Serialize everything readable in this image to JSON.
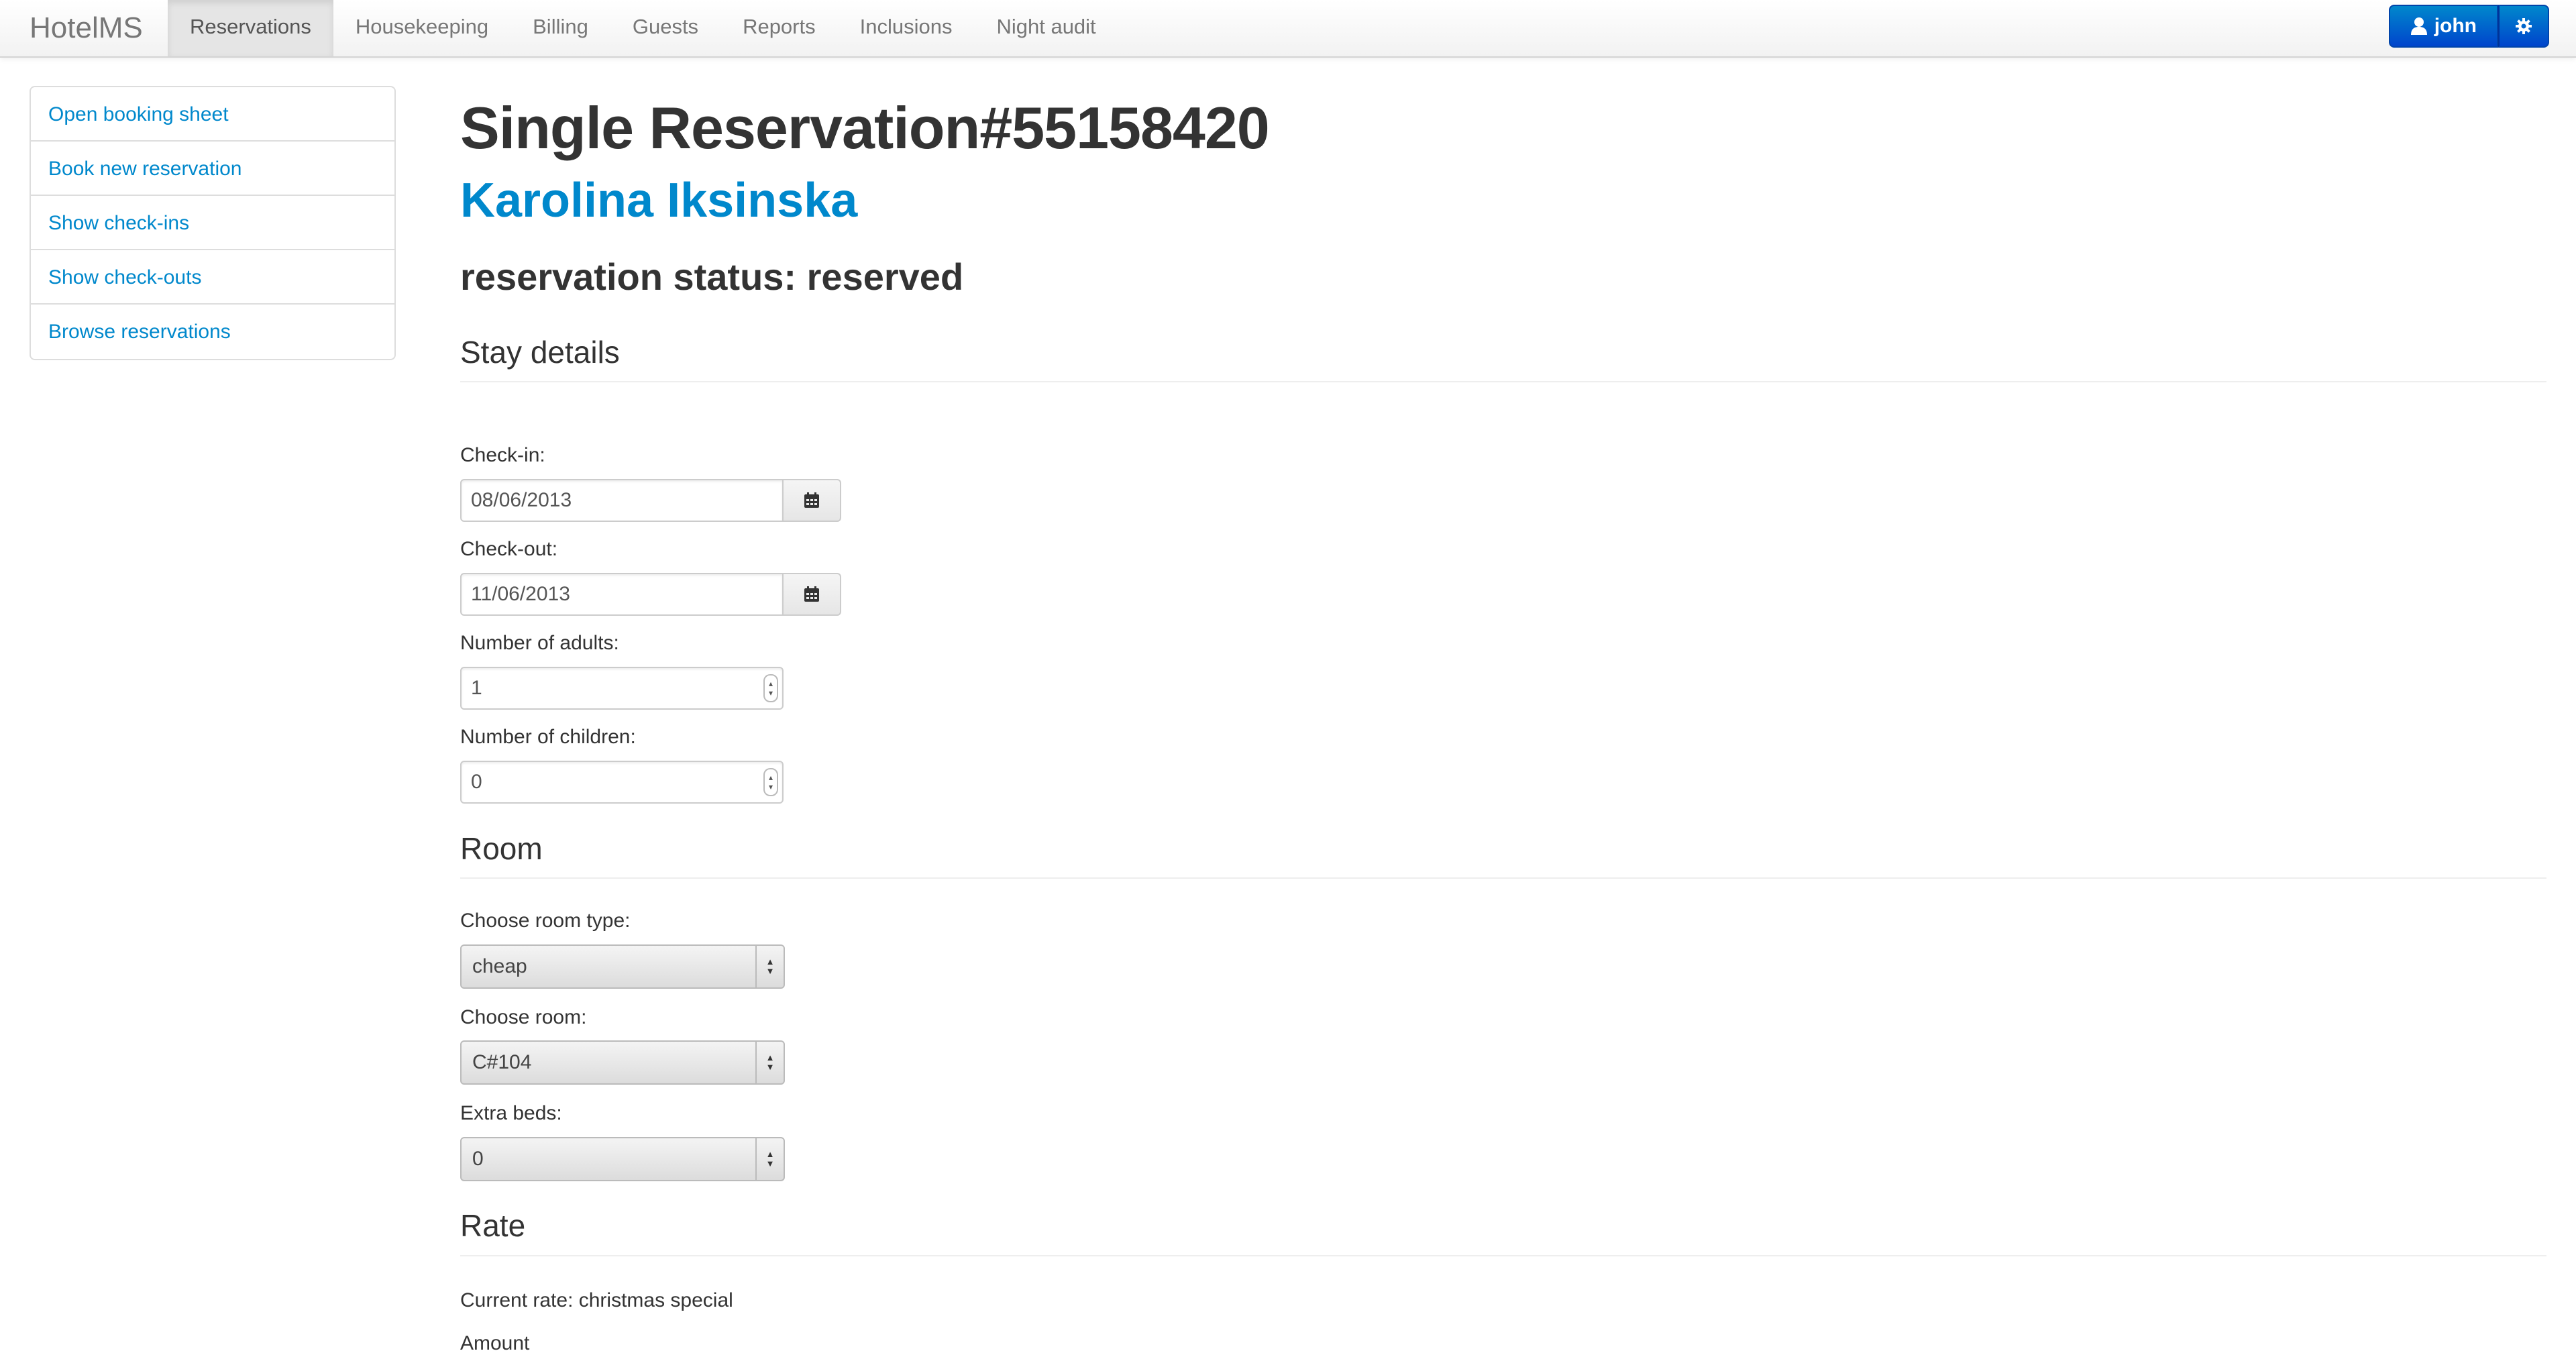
{
  "app": {
    "brand": "HotelMS"
  },
  "nav": {
    "items": [
      "Reservations",
      "Housekeeping",
      "Billing",
      "Guests",
      "Reports",
      "Inclusions",
      "Night audit"
    ],
    "active": "Reservations"
  },
  "user": {
    "name": "john",
    "user_icon": "user-icon",
    "settings_icon": "gear-icon"
  },
  "sidebar": {
    "items": [
      "Open booking sheet",
      "Book new reservation",
      "Show check-ins",
      "Show check-outs",
      "Browse reservations"
    ]
  },
  "page": {
    "title": "Single Reservation#55158420",
    "guest_name": "Karolina Iksinska",
    "status": "reservation status: reserved"
  },
  "stay": {
    "title": "Stay details",
    "checkin_label": "Check-in:",
    "checkin_value": "08/06/2013",
    "checkout_label": "Check-out:",
    "checkout_value": "11/06/2013",
    "adults_label": "Number of adults:",
    "adults_value": "1",
    "children_label": "Number of children:",
    "children_value": "0",
    "calendar_icon": "calendar-icon"
  },
  "room": {
    "title": "Room",
    "type_label": "Choose room type:",
    "type_value": "cheap",
    "room_label": "Choose room:",
    "room_value": "C#104",
    "beds_label": "Extra beds:",
    "beds_value": "0"
  },
  "rate": {
    "title": "Rate",
    "current": "Current rate: christmas special",
    "amount_label": "Amount"
  },
  "colors": {
    "link": "#0088cc",
    "primary_button": "#0066cc"
  }
}
